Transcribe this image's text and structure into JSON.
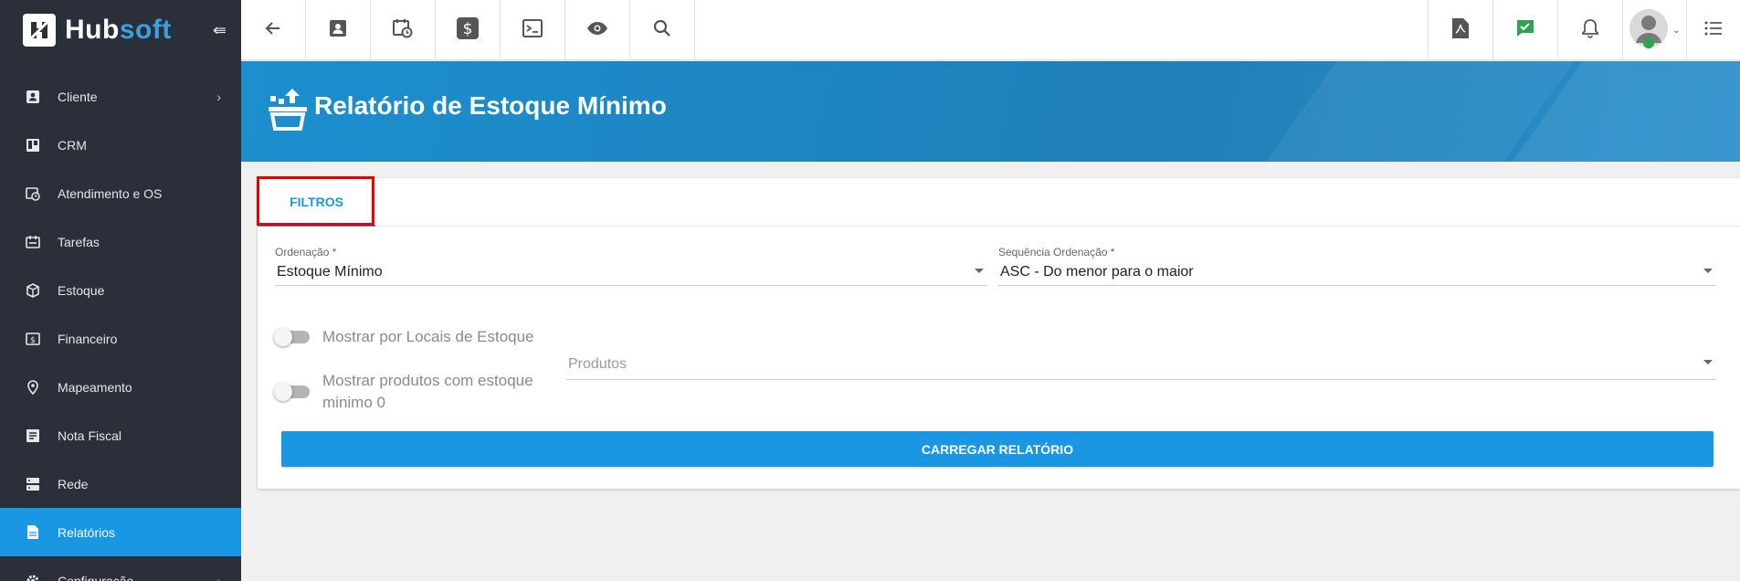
{
  "brand": {
    "name_part1": "Hub",
    "name_part2": "soft",
    "collapse_icon": "collapse-icon"
  },
  "sidebar": {
    "items": [
      {
        "label": "Cliente",
        "icon": "contact-card-icon",
        "has_submenu": true
      },
      {
        "label": "CRM",
        "icon": "kanban-icon",
        "has_submenu": false
      },
      {
        "label": "Atendimento e OS",
        "icon": "calendar-clock-icon",
        "has_submenu": false
      },
      {
        "label": "Tarefas",
        "icon": "task-icon",
        "has_submenu": false
      },
      {
        "label": "Estoque",
        "icon": "box-icon",
        "has_submenu": false
      },
      {
        "label": "Financeiro",
        "icon": "money-icon",
        "has_submenu": false
      },
      {
        "label": "Mapeamento",
        "icon": "map-pin-icon",
        "has_submenu": false
      },
      {
        "label": "Nota Fiscal",
        "icon": "receipt-icon",
        "has_submenu": false
      },
      {
        "label": "Rede",
        "icon": "server-icon",
        "has_submenu": false
      },
      {
        "label": "Relatórios",
        "icon": "report-icon",
        "has_submenu": false,
        "active": true
      },
      {
        "label": "Configuração",
        "icon": "gear-icon",
        "has_submenu": true
      }
    ]
  },
  "topbar": {
    "left_icons": [
      "back-arrow-icon",
      "contact-card-icon",
      "calendar-clock-icon",
      "dollar-icon",
      "terminal-icon",
      "eye-icon",
      "search-icon"
    ],
    "right_icons": [
      "pdf-icon",
      "chat-check-icon",
      "bell-icon",
      "avatar",
      "list-icon"
    ]
  },
  "page": {
    "title": "Relatório de Estoque Mínimo"
  },
  "tabs": [
    {
      "label": "FILTROS"
    }
  ],
  "form": {
    "ordenacao": {
      "label": "Ordenação *",
      "value": "Estoque Mínimo"
    },
    "sequencia": {
      "label": "Sequência Ordenação *",
      "value": "ASC - Do menor para o maior"
    },
    "toggle_locais": {
      "label": "Mostrar por Locais de Estoque",
      "checked": false
    },
    "toggle_minimo": {
      "label": "Mostrar produtos com estoque minimo 0",
      "checked": false
    },
    "produtos": {
      "placeholder": "Produtos"
    },
    "submit_label": "CARREGAR RELATÓRIO"
  },
  "colors": {
    "primary": "#1997e3",
    "sidebar_bg": "#2b2f3a",
    "highlight": "#e50000",
    "chat_icon": "#2ea44f"
  }
}
